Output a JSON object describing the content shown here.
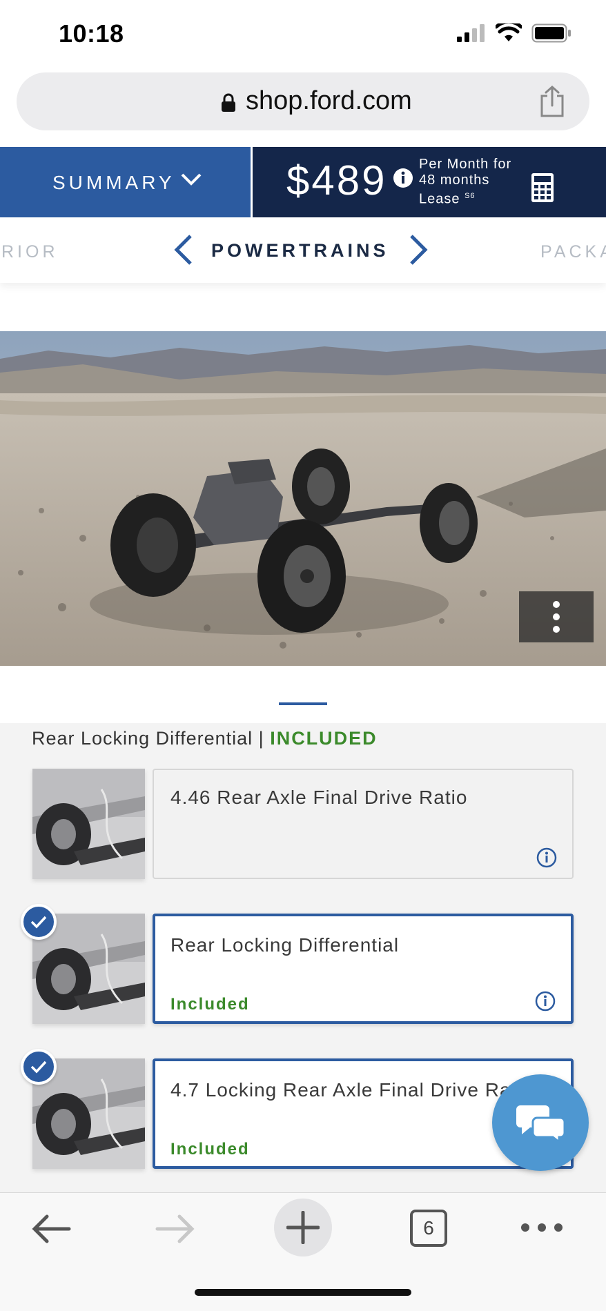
{
  "status_bar": {
    "time": "10:18"
  },
  "browser": {
    "url": "shop.ford.com",
    "open_tabs": "6"
  },
  "summary": {
    "label": "SUMMARY",
    "price": "$489",
    "price_terms": [
      "Per Month for",
      "48 months",
      "Lease"
    ],
    "price_footnote": "S6"
  },
  "category_nav": {
    "previous": "RIOR",
    "current": "POWERTRAINS",
    "next": "PACKA"
  },
  "options": {
    "header_label": "Rear Locking Differential |",
    "header_status": "INCLUDED",
    "items": [
      {
        "title": "4.46 Rear Axle Final Drive Ratio",
        "status": "",
        "selected": false
      },
      {
        "title": "Rear Locking Differential",
        "status": "Included",
        "selected": true
      },
      {
        "title": "4.7 Locking Rear Axle Final Drive Ratio",
        "status": "Included",
        "selected": true
      }
    ]
  },
  "icons": {
    "lock": "lock-icon",
    "share": "share-icon",
    "chevron": "chevron-down-icon",
    "info": "info-icon",
    "calculator": "calculator-icon",
    "check": "check-icon",
    "chat": "chat-icon",
    "back": "back-arrow-icon",
    "forward": "forward-arrow-icon",
    "new_tab": "plus-icon",
    "more": "more-dots-icon"
  },
  "colors": {
    "brand_blue": "#2c5ba0",
    "navy": "#14264a",
    "included_green": "#3b8a2b",
    "chat_blue": "#4e97d1"
  }
}
